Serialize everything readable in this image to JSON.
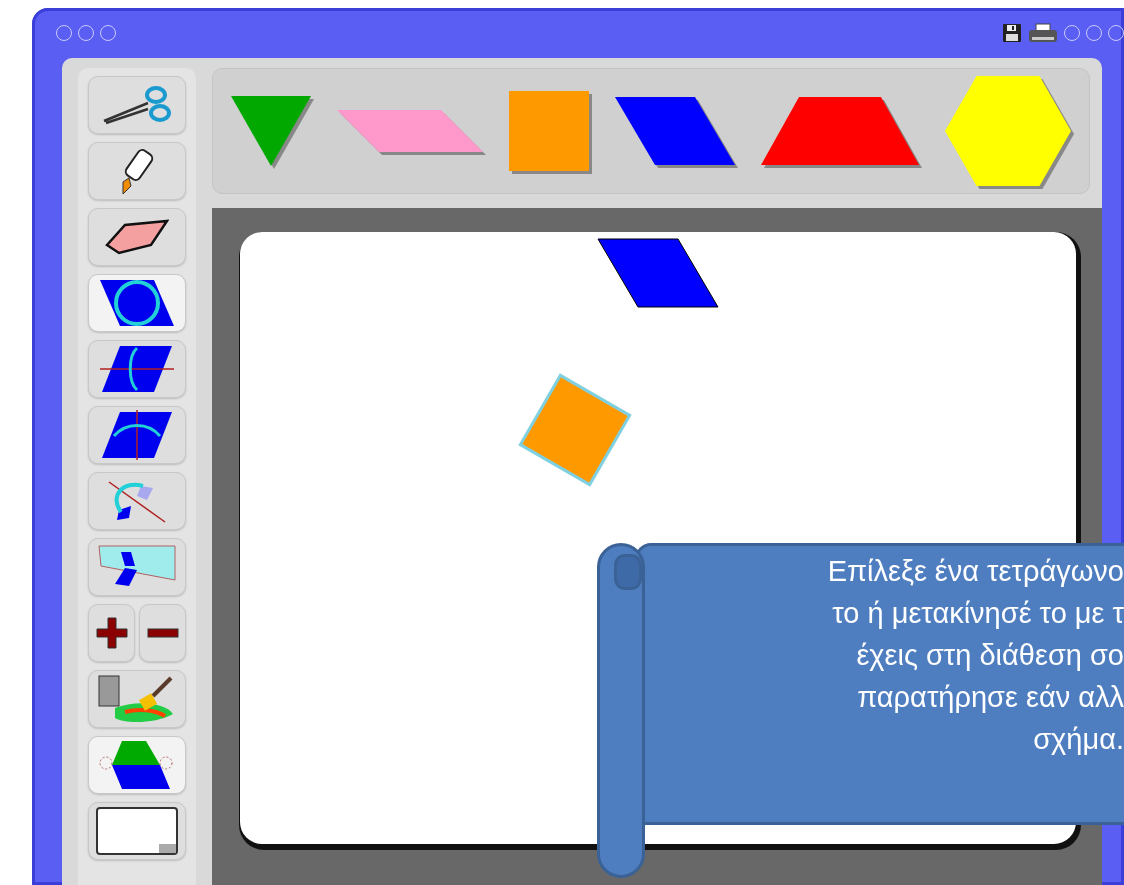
{
  "tools": [
    {
      "kind": "scissors",
      "selected": false
    },
    {
      "kind": "glue",
      "selected": false
    },
    {
      "kind": "eraser",
      "selected": false
    },
    {
      "kind": "rotate",
      "selected": true
    },
    {
      "kind": "flip-horizontal",
      "selected": false
    },
    {
      "kind": "flip-vertical",
      "selected": false
    },
    {
      "kind": "reflect",
      "selected": false
    },
    {
      "kind": "mirror",
      "selected": false
    },
    {
      "kind": "plus",
      "selected": false
    },
    {
      "kind": "minus",
      "selected": false
    },
    {
      "kind": "paint",
      "selected": false
    },
    {
      "kind": "combine",
      "selected": true
    },
    {
      "kind": "blank",
      "selected": false
    }
  ],
  "tray": [
    {
      "kind": "triangle",
      "color": "#00a800"
    },
    {
      "kind": "thin-rhombus",
      "color": "#ff99cc"
    },
    {
      "kind": "square",
      "color": "#ff9900"
    },
    {
      "kind": "rhombus",
      "color": "#0000ff"
    },
    {
      "kind": "trapezoid",
      "color": "#ff0000"
    },
    {
      "kind": "hexagon",
      "color": "#ffff00"
    }
  ],
  "canvas_pieces": [
    {
      "kind": "rhombus",
      "color": "#0000ff",
      "selected": false
    },
    {
      "kind": "square",
      "color": "#ff9900",
      "selected": true
    }
  ],
  "instruction": {
    "lines": [
      "Επίλεξε ένα τετράγωνο",
      "το ή μετακίνησέ το με τ",
      "έχεις στη διάθεση σο",
      "παρατήρησε εάν αλλ",
      "σχήμα."
    ]
  }
}
